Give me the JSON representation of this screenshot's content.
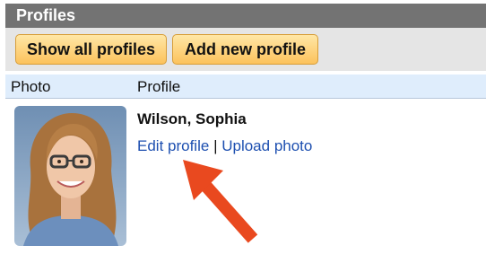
{
  "panel": {
    "title": "Profiles"
  },
  "toolbar": {
    "show_all_label": "Show all profiles",
    "add_new_label": "Add new profile"
  },
  "table": {
    "headers": [
      "Photo",
      "Profile"
    ],
    "rows": [
      {
        "name": "Wilson, Sophia",
        "edit_label": "Edit profile",
        "separator": "|",
        "upload_label": "Upload photo"
      }
    ]
  },
  "annotation": {
    "arrow_color": "#e9491f",
    "arrow_icon": "arrow-up-left-icon"
  }
}
